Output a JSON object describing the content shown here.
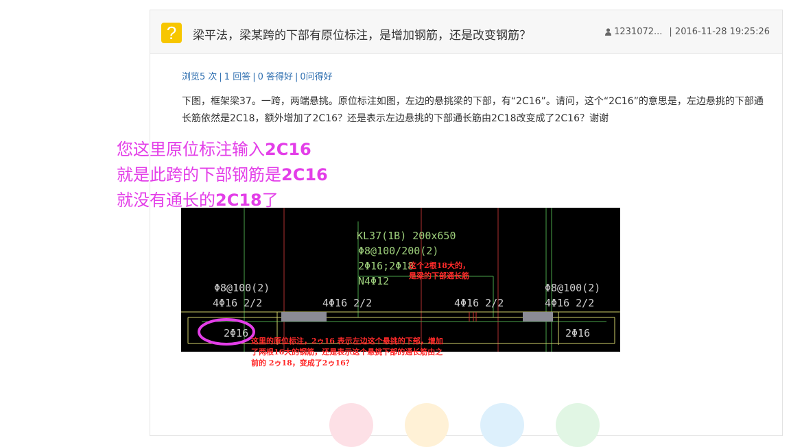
{
  "question": {
    "icon_char": "?",
    "title": "梁平法，梁某跨的下部有原位标注，是增加钢筋，还是改变钢筋？",
    "user": "1231072...",
    "datetime": "| 2016-11-28 19:25:26"
  },
  "stats": {
    "views": "浏览5 次",
    "answers": "1 回答",
    "good": "0 答得好",
    "asked": "0问得好"
  },
  "body_text": "下图，框架梁37。一跨，两端悬挑。原位标注如图，左边的悬挑梁的下部，有“2C16”。请问，这个“2C16”的意思是，左边悬挑的下部通长筋依然是2C18，额外增加了2C16？还是表示左边悬挑的下部通长筋由2C18改变成了2C16？谢谢",
  "overlay": {
    "line1_a": "您这里原位标注输入",
    "line1_b": "2C16",
    "line2_a": "就是此跨的下部钢筋是",
    "line2_b": "2C16",
    "line3_a": "就没有通长的",
    "line3_b": "2C18",
    "line3_c": "了"
  },
  "cad": {
    "beam_id": "KL37(1B) 200x650",
    "stirrup_main": "Φ8@100/200(2)",
    "top_bars": "2Φ16;2Φ18",
    "side_bars": "N4Φ12",
    "left_stirrup": "Φ8@100(2)",
    "left_bottom": "4Φ16 2/2",
    "mid_left": "4Φ16 2/2",
    "mid_right": "4Φ16 2/2",
    "right_stirrup": "Φ8@100(2)",
    "right_bottom": "4Φ16 2/2",
    "circled_label": "2Φ16",
    "right_label": "2Φ16",
    "note_top_1": "这个2根18大的，",
    "note_top_2": "是梁的下部通长筋",
    "note_bottom_1": "这里的原位标注，2ゥ16 表示左边这个悬挑的下部，增加",
    "note_bottom_2": "了两根16大的钢筋，还是表示这个悬挑下部的通长筋由之",
    "note_bottom_3": "前的 2ゥ18，变成了2ゥ16？",
    "colors": {
      "background": "#000000",
      "text_green": "#9ed07c",
      "circle": "#e33ee8",
      "note_red": "#ff2a2a"
    }
  },
  "action_icons": [
    "thumbs-up-icon",
    "star-icon",
    "share-icon",
    "more-icon"
  ]
}
